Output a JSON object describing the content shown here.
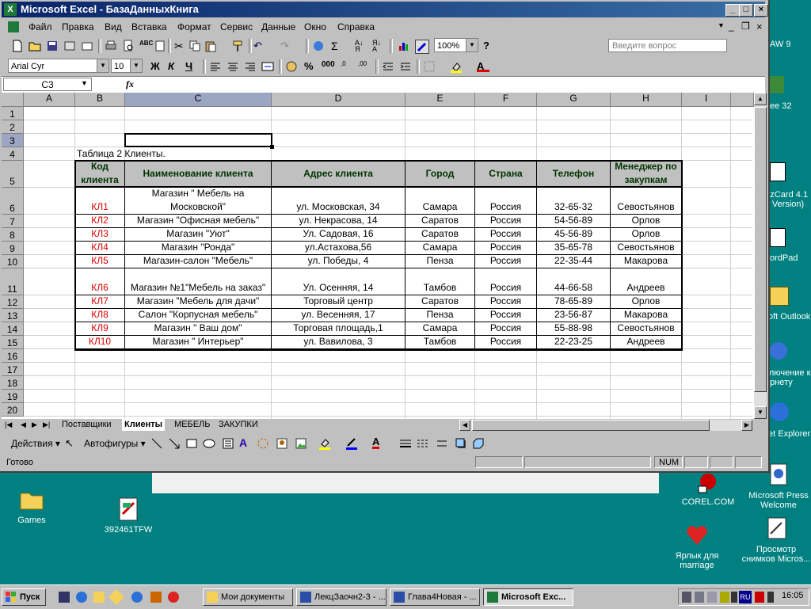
{
  "window": {
    "title": "Microsoft Excel - БазаДанныхКнига",
    "ask_placeholder": "Введите вопрос"
  },
  "menu": [
    "Файл",
    "Правка",
    "Вид",
    "Вставка",
    "Формат",
    "Сервис",
    "Данные",
    "Окно",
    "Справка"
  ],
  "toolbar": {
    "zoom": "100%"
  },
  "format_toolbar": {
    "font": "Arial Cyr",
    "size": "10",
    "bold": "Ж",
    "italic": "К",
    "underline": "Ч",
    "thousands": "000"
  },
  "formula_bar": {
    "cell_ref": "C3",
    "fx": "fx",
    "formula": ""
  },
  "columns": [
    "A",
    "B",
    "C",
    "D",
    "E",
    "F",
    "G",
    "H",
    "I"
  ],
  "rows": [
    "1",
    "2",
    "3",
    "4",
    "5",
    "6",
    "7",
    "8",
    "9",
    "10",
    "11",
    "12",
    "13",
    "14",
    "15",
    "16",
    "17",
    "18",
    "19",
    "20"
  ],
  "sheet": {
    "caption": "Таблица 2 Клиенты.",
    "headers": [
      "Код клиента",
      "Наименование клиента",
      "Адрес клиента",
      "Город",
      "Страна",
      "Телефон",
      "Менеджер по закупкам"
    ],
    "rows": [
      [
        "КЛ1",
        "Магазин \" Мебель на Московской\"",
        "ул. Московская, 34",
        "Самара",
        "Россия",
        "32-65-32",
        "Севостьянов"
      ],
      [
        "КЛ2",
        "Магазин \"Офисная мебель\"",
        "ул. Некрасова, 14",
        "Саратов",
        "Россия",
        "54-56-89",
        "Орлов"
      ],
      [
        "КЛ3",
        "Магазин \"Уют\"",
        "Ул. Садовая, 16",
        "Саратов",
        "Россия",
        "45-56-89",
        "Орлов"
      ],
      [
        "КЛ4",
        "Магазин \"Ронда\"",
        "ул.Астахова,56",
        "Самара",
        "Россия",
        "35-65-78",
        "Севостьянов"
      ],
      [
        "КЛ5",
        "Магазин-салон \"Мебель\"",
        "ул. Победы, 4",
        "Пенза",
        "Россия",
        "22-35-44",
        "Макарова"
      ],
      [
        "КЛ6",
        "Магазин №1\"Мебель на заказ\"",
        "Ул. Осенняя, 14",
        "Тамбов",
        "Россия",
        "44-66-58",
        "Андреев"
      ],
      [
        "КЛ7",
        "Магазин \"Мебель для дачи\"",
        "Торговый центр",
        "Саратов",
        "Россия",
        "78-65-89",
        "Орлов"
      ],
      [
        "КЛ8",
        "Салон \"Корпусная мебель\"",
        "ул. Весенняя, 17",
        "Пенза",
        "Россия",
        "23-56-87",
        "Макарова"
      ],
      [
        "КЛ9",
        "Магазин \" Ваш дом\"",
        "Торговая площадь,1",
        "Самара",
        "Россия",
        "55-88-98",
        "Севостьянов"
      ],
      [
        "КЛ10",
        "Магазин \" Интерьер\"",
        "ул. Вавилова, 3",
        "Тамбов",
        "Россия",
        "22-23-25",
        "Андреев"
      ]
    ]
  },
  "tabs": [
    "Поставщики",
    "Клиенты",
    "МЕБЕЛЬ",
    "ЗАКУПКИ"
  ],
  "drawing": {
    "actions": "Действия",
    "autoshapes": "Автофигуры"
  },
  "status": {
    "ready": "Готово",
    "num": "NUM"
  },
  "desktop": {
    "games": "Games",
    "file": "392461TFW",
    "corel": "COREL.COM",
    "press": "Microsoft Press Welcome",
    "marriage": "Ярлык для marriage",
    "viewer": "Просмотр снимков Micros...",
    "clip1": "AW 9",
    "clip2": "ee 32",
    "clip3": "izCard 4.1 Version)",
    "clip4": "ordPad",
    "clip5": "oft Outlook",
    "clip6": "ключение к ернету",
    "clip7": "et Explorer"
  },
  "taskbar": {
    "start": "Пуск",
    "items": [
      "Мои документы",
      "ЛекцЗаочн2-3 - ...",
      "Глава4Новая - ...",
      "Microsoft Exc..."
    ],
    "time": "16:05",
    "lang": "RU"
  }
}
